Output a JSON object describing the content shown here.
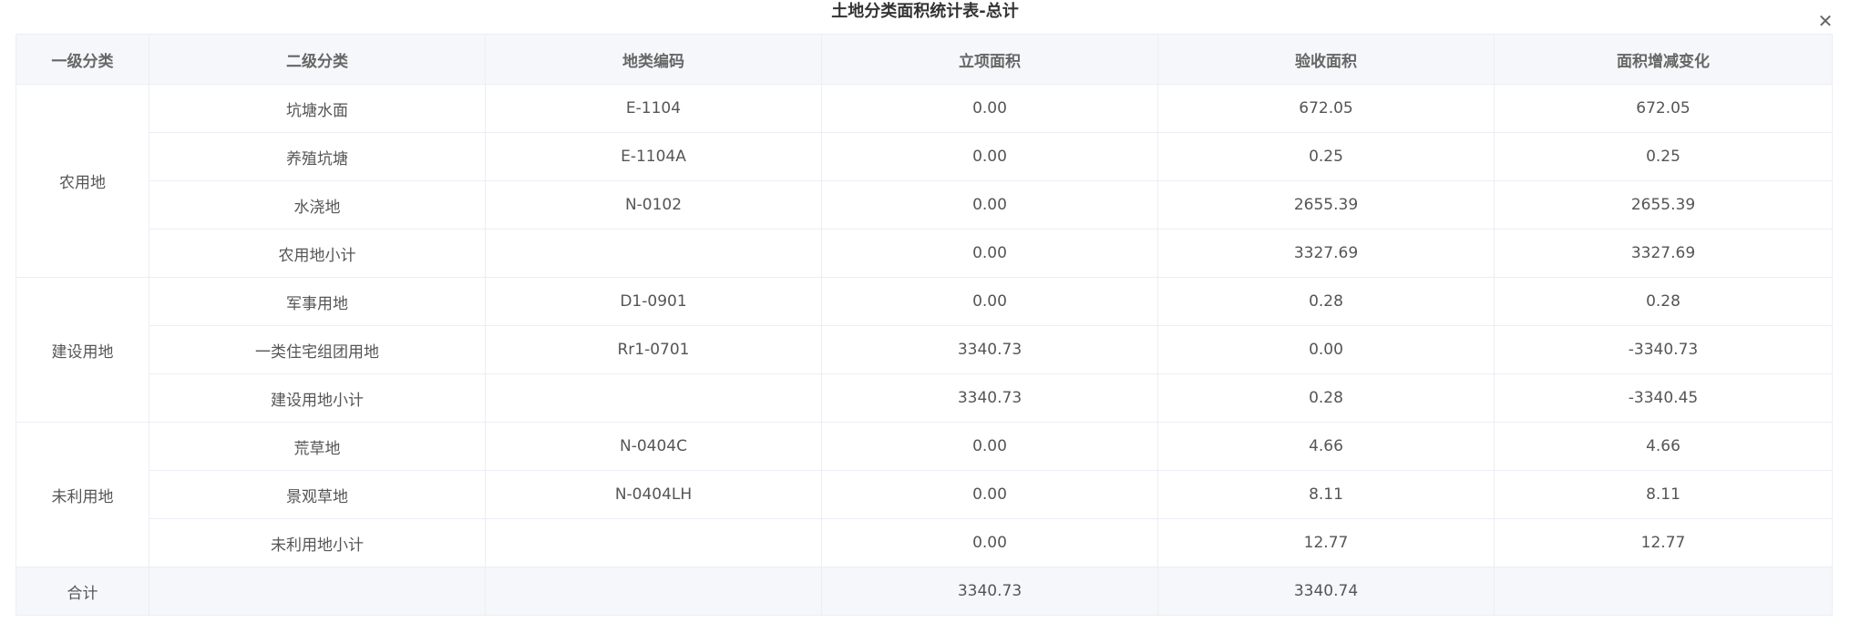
{
  "modal": {
    "title": "土地分类面积统计表-总计",
    "close_icon": "close-icon"
  },
  "table": {
    "headers": [
      "一级分类",
      "二级分类",
      "地类编码",
      "立项面积",
      "验收面积",
      "面积增减变化"
    ],
    "groups": [
      {
        "level1": "农用地",
        "rows": [
          {
            "level2": "坑塘水面",
            "code": "E-1104",
            "project_area": "0.00",
            "accept_area": "672.05",
            "change": "672.05"
          },
          {
            "level2": "养殖坑塘",
            "code": "E-1104A",
            "project_area": "0.00",
            "accept_area": "0.25",
            "change": "0.25"
          },
          {
            "level2": "水浇地",
            "code": "N-0102",
            "project_area": "0.00",
            "accept_area": "2655.39",
            "change": "2655.39"
          },
          {
            "level2": "农用地小计",
            "code": "",
            "project_area": "0.00",
            "accept_area": "3327.69",
            "change": "3327.69"
          }
        ]
      },
      {
        "level1": "建设用地",
        "rows": [
          {
            "level2": "军事用地",
            "code": "D1-0901",
            "project_area": "0.00",
            "accept_area": "0.28",
            "change": "0.28"
          },
          {
            "level2": "一类住宅组团用地",
            "code": "Rr1-0701",
            "project_area": "3340.73",
            "accept_area": "0.00",
            "change": "-3340.73"
          },
          {
            "level2": "建设用地小计",
            "code": "",
            "project_area": "3340.73",
            "accept_area": "0.28",
            "change": "-3340.45"
          }
        ]
      },
      {
        "level1": "未利用地",
        "rows": [
          {
            "level2": "荒草地",
            "code": "N-0404C",
            "project_area": "0.00",
            "accept_area": "4.66",
            "change": "4.66"
          },
          {
            "level2": "景观草地",
            "code": "N-0404LH",
            "project_area": "0.00",
            "accept_area": "8.11",
            "change": "8.11"
          },
          {
            "level2": "未利用地小计",
            "code": "",
            "project_area": "0.00",
            "accept_area": "12.77",
            "change": "12.77"
          }
        ]
      }
    ],
    "total": {
      "label": "合计",
      "level2": "",
      "code": "",
      "project_area": "3340.73",
      "accept_area": "3340.74",
      "change": ""
    }
  }
}
